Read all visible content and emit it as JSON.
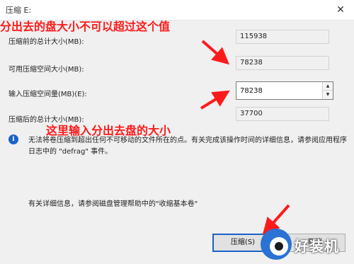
{
  "window": {
    "title": "压缩 E:"
  },
  "fields": [
    {
      "label": "压缩前的总计大小(MB):",
      "value": "115938"
    },
    {
      "label": "可用压缩空间大小(MB):",
      "value": "78238"
    },
    {
      "label": "输入压缩空间量(MB)(E):",
      "value": "78238"
    },
    {
      "label": "压缩后的总计大小(MB):",
      "value": "37700"
    }
  ],
  "info": {
    "text": "无法将卷压缩到超出任何不可移动的文件所在的点。有关完成该操作时间的详细信息，请参阅应用程序日志中的 \"defrag\" 事件。"
  },
  "help": {
    "text": "有关详细信息，请参阅磁盘管理帮助中的\"收缩基本卷\""
  },
  "buttons": {
    "compress": "压缩(S)",
    "cancel": "取消"
  },
  "annotations": {
    "top": "分出去的盘大小不可以超过这个值",
    "middle": "这里输入分出去盘的大小",
    "color": "#ff1a1a"
  },
  "watermark": {
    "text": "好装机"
  },
  "icons": {
    "info": "info-icon",
    "close": "close-icon"
  },
  "colors": {
    "accent": "#1a62c7",
    "background": "#f0f0f0"
  }
}
